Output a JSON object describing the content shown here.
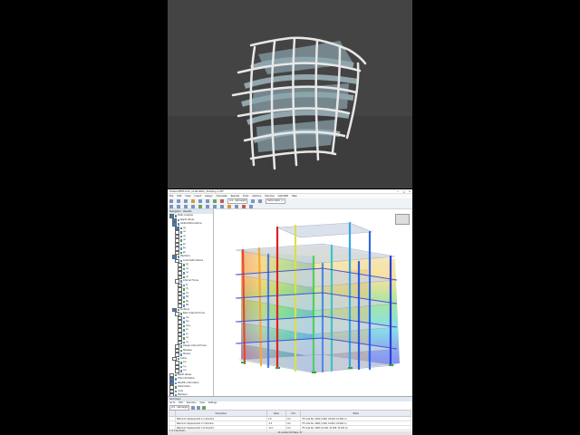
{
  "app": {
    "title": "Dlubal RFEM 6.01 | 6.06.0001 | Building 1.rf6*",
    "window_controls": [
      "—",
      "□",
      "✕"
    ]
  },
  "menubar": [
    "File",
    "Edit",
    "View",
    "Insert",
    "Assign",
    "Calculate",
    "Results",
    "Tools",
    "Options",
    "Window",
    "CAD-BIM",
    "Help"
  ],
  "toolbar": {
    "loading_combo": "LC1 - Self-weight",
    "result_combo": "Deformation | u"
  },
  "navigator": {
    "title": "Navigator - Results",
    "items": [
      {
        "label": "Static Analysis",
        "checked": true,
        "indent": 0
      },
      {
        "label": "Result Values",
        "checked": true,
        "indent": 1
      },
      {
        "label": "Global Deformations",
        "checked": true,
        "indent": 1
      },
      {
        "label": "|u|",
        "checked": true,
        "indent": 2
      },
      {
        "label": "ux",
        "checked": false,
        "indent": 2
      },
      {
        "label": "uy",
        "checked": false,
        "indent": 2
      },
      {
        "label": "uz",
        "checked": false,
        "indent": 2
      },
      {
        "label": "φx",
        "checked": false,
        "indent": 2
      },
      {
        "label": "φy",
        "checked": false,
        "indent": 2
      },
      {
        "label": "φz",
        "checked": false,
        "indent": 2
      },
      {
        "label": "Members",
        "checked": true,
        "indent": 1
      },
      {
        "label": "Local Deformations",
        "checked": false,
        "indent": 2
      },
      {
        "label": "|u|",
        "checked": false,
        "indent": 3
      },
      {
        "label": "ux",
        "checked": false,
        "indent": 3
      },
      {
        "label": "uy",
        "checked": false,
        "indent": 3
      },
      {
        "label": "uz",
        "checked": false,
        "indent": 3
      },
      {
        "label": "Internal Forces",
        "checked": false,
        "indent": 2
      },
      {
        "label": "N",
        "checked": false,
        "indent": 3
      },
      {
        "label": "Vy",
        "checked": false,
        "indent": 3
      },
      {
        "label": "Vz",
        "checked": false,
        "indent": 3
      },
      {
        "label": "MT",
        "checked": false,
        "indent": 3
      },
      {
        "label": "My",
        "checked": false,
        "indent": 3
      },
      {
        "label": "Mz",
        "checked": false,
        "indent": 3
      },
      {
        "label": "Surfaces",
        "checked": true,
        "indent": 1
      },
      {
        "label": "Basic Internal Forces",
        "checked": false,
        "indent": 2
      },
      {
        "label": "mx",
        "checked": false,
        "indent": 3
      },
      {
        "label": "my",
        "checked": false,
        "indent": 3
      },
      {
        "label": "mxy",
        "checked": false,
        "indent": 3
      },
      {
        "label": "vx",
        "checked": false,
        "indent": 3
      },
      {
        "label": "vy",
        "checked": false,
        "indent": 3
      },
      {
        "label": "nx",
        "checked": false,
        "indent": 3
      },
      {
        "label": "ny",
        "checked": false,
        "indent": 3
      },
      {
        "label": "Design Internal Forces",
        "checked": false,
        "indent": 2
      },
      {
        "label": "Stresses",
        "checked": false,
        "indent": 2
      },
      {
        "label": "Strains",
        "checked": false,
        "indent": 2
      },
      {
        "label": "Solids",
        "checked": false,
        "indent": 1
      },
      {
        "label": "σ-x",
        "checked": false,
        "indent": 2
      },
      {
        "label": "σ-y",
        "checked": false,
        "indent": 2
      },
      {
        "label": "σ-z",
        "checked": false,
        "indent": 2
      },
      {
        "label": "Result Values",
        "checked": false,
        "indent": 0
      },
      {
        "label": "Title Information",
        "checked": true,
        "indent": 0
      },
      {
        "label": "Max/Min Information",
        "checked": true,
        "indent": 0
      },
      {
        "label": "Deformation",
        "checked": false,
        "indent": 0
      },
      {
        "label": "Lines",
        "checked": false,
        "indent": 0
      },
      {
        "label": "Members",
        "checked": false,
        "indent": 0
      },
      {
        "label": "Surfaces",
        "checked": false,
        "indent": 0
      },
      {
        "label": "Values on Surfaces",
        "checked": false,
        "indent": 0
      },
      {
        "label": "Type of display",
        "checked": false,
        "indent": 0
      },
      {
        "label": "Ribs - Effective Contribution on Surfaces",
        "checked": false,
        "indent": 0
      },
      {
        "label": "Support Reactions",
        "checked": false,
        "indent": 0
      },
      {
        "label": "Result Sections",
        "checked": false,
        "indent": 0
      }
    ]
  },
  "results": {
    "title": "Summary",
    "menu": [
      "Go To",
      "Edit",
      "Selection",
      "View",
      "Settings"
    ],
    "columns": [
      "",
      "Description",
      "Value",
      "Unit",
      "Notes"
    ],
    "rows": [
      [
        "",
        "Maximum displacement in X-direction",
        "1.8",
        "mm",
        "FE node No. 2049 (3.960, 26.064, 15.400 m)"
      ],
      [
        "",
        "Maximum displacement in Y-direction",
        "-3.0",
        "mm",
        "FE node No. 4066 (1.918, 19.891, 24.900 m)"
      ],
      [
        "",
        "Maximum displacement in Z-direction",
        "-12.1",
        "mm",
        "FE node No. 1982 (31.040, 22.009, 15.400 m)"
      ],
      [
        "",
        "Maximum vectorial displacement",
        "12.2",
        "mm",
        "FE node No. 1982 (31.040, 22.009, 15.400 m)"
      ]
    ],
    "tab": "1 of 1  Summary"
  },
  "status": "CS: Global XYZ  Plane: XY",
  "colors": {
    "background_top": "#444444",
    "accent": "#3b7bd0",
    "max": "#e02020",
    "min": "#1f2bd8"
  }
}
